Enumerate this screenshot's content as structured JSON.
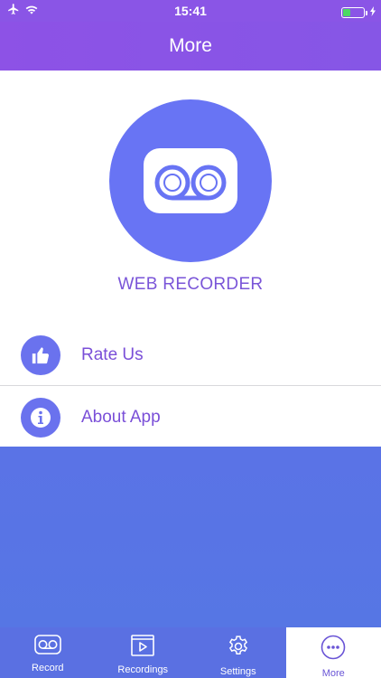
{
  "status_bar": {
    "time": "15:41"
  },
  "nav": {
    "title": "More"
  },
  "app": {
    "name": "WEB RECORDER"
  },
  "menu": [
    {
      "label": "Rate Us",
      "icon": "thumbs-up-icon"
    },
    {
      "label": "About App",
      "icon": "info-icon"
    }
  ],
  "tabs": [
    {
      "label": "Record",
      "icon": "cassette-icon",
      "active": false
    },
    {
      "label": "Recordings",
      "icon": "video-file-icon",
      "active": false
    },
    {
      "label": "Settings",
      "icon": "gear-icon",
      "active": false
    },
    {
      "label": "More",
      "icon": "more-icon",
      "active": true
    }
  ],
  "colors": {
    "header": "#8a55e6",
    "accent": "#6a72ee",
    "text_purple": "#7a4fd8",
    "background_gradient": "#5b72e6"
  }
}
